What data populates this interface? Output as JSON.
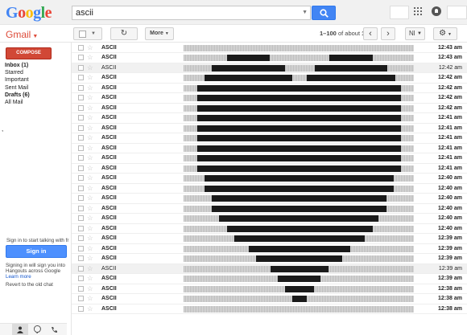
{
  "header": {
    "logo_text": "Google",
    "logo_colors": [
      "#4285f4",
      "#ea4335",
      "#fbbc05",
      "#4285f4",
      "#34a853",
      "#ea4335"
    ],
    "search_value": "ascii",
    "search_icon": "search-icon",
    "apps_icon": "apps-grid-icon",
    "notifications_icon": "notifications-icon"
  },
  "toolbar": {
    "app_label": "Gmail",
    "more_label": "More",
    "page_range": "1–100",
    "page_of": "of about",
    "page_total": "171",
    "prev_icon": "‹",
    "next_icon": "›",
    "lang_label": "Nl",
    "settings_icon": "⚙",
    "refresh_icon": "↻"
  },
  "sidebar": {
    "compose_label": "COMPOSE",
    "items": [
      {
        "label": "Inbox (1)",
        "bold": true
      },
      {
        "label": "Starred",
        "bold": false
      },
      {
        "label": "Important",
        "bold": false
      },
      {
        "label": "Sent Mail",
        "bold": false
      },
      {
        "label": "Drafts (6)",
        "bold": true
      },
      {
        "label": "All Mail",
        "bold": false
      }
    ],
    "stray_comma": ",",
    "chat_prompt": "Sign in to start talking with fr",
    "signin_label": "Sign in",
    "chat_note": "Signing in will sign you into Hangouts across Google",
    "learn_more": "Learn more",
    "old_chat": "Revert to the old chat"
  },
  "colors": {
    "accent_red": "#dd4b39",
    "compose_red": "#d14836",
    "blue_button": "#4285f4",
    "bar_black": "#1a1a1a"
  },
  "mails": [
    {
      "sender": "ASCII",
      "time": "12:43 am",
      "read": false,
      "bars": []
    },
    {
      "sender": "ASCII",
      "time": "12:43 am",
      "read": false,
      "bars": [
        [
          0.188,
          0.374
        ],
        [
          0.634,
          0.82
        ]
      ]
    },
    {
      "sender": "ASCII",
      "time": "12:42 am",
      "read": true,
      "bars": [
        [
          0.122,
          0.44
        ],
        [
          0.569,
          0.886
        ]
      ]
    },
    {
      "sender": "ASCII",
      "time": "12:42 am",
      "read": false,
      "bars": [
        [
          0.09,
          0.472
        ],
        [
          0.536,
          0.918
        ]
      ]
    },
    {
      "sender": "ASCII",
      "time": "12:42 am",
      "read": false,
      "bars": [
        [
          0.058,
          0.944
        ]
      ]
    },
    {
      "sender": "ASCII",
      "time": "12:42 am",
      "read": false,
      "bars": [
        [
          0.058,
          0.944
        ]
      ]
    },
    {
      "sender": "ASCII",
      "time": "12:42 am",
      "read": false,
      "bars": [
        [
          0.058,
          0.944
        ]
      ]
    },
    {
      "sender": "ASCII",
      "time": "12:41 am",
      "read": false,
      "bars": [
        [
          0.058,
          0.944
        ]
      ]
    },
    {
      "sender": "ASCII",
      "time": "12:41 am",
      "read": false,
      "bars": [
        [
          0.058,
          0.944
        ]
      ]
    },
    {
      "sender": "ASCII",
      "time": "12:41 am",
      "read": false,
      "bars": [
        [
          0.058,
          0.944
        ]
      ]
    },
    {
      "sender": "ASCII",
      "time": "12:41 am",
      "read": false,
      "bars": [
        [
          0.058,
          0.944
        ]
      ]
    },
    {
      "sender": "ASCII",
      "time": "12:41 am",
      "read": false,
      "bars": [
        [
          0.058,
          0.944
        ]
      ]
    },
    {
      "sender": "ASCII",
      "time": "12:41 am",
      "read": false,
      "bars": [
        [
          0.058,
          0.944
        ]
      ]
    },
    {
      "sender": "ASCII",
      "time": "12:40 am",
      "read": false,
      "bars": [
        [
          0.09,
          0.912
        ]
      ]
    },
    {
      "sender": "ASCII",
      "time": "12:40 am",
      "read": false,
      "bars": [
        [
          0.09,
          0.912
        ]
      ]
    },
    {
      "sender": "ASCII",
      "time": "12:40 am",
      "read": false,
      "bars": [
        [
          0.122,
          0.88
        ]
      ]
    },
    {
      "sender": "ASCII",
      "time": "12:40 am",
      "read": false,
      "bars": [
        [
          0.122,
          0.88
        ]
      ]
    },
    {
      "sender": "ASCII",
      "time": "12:40 am",
      "read": false,
      "bars": [
        [
          0.154,
          0.846
        ]
      ]
    },
    {
      "sender": "ASCII",
      "time": "12:40 am",
      "read": false,
      "bars": [
        [
          0.188,
          0.82
        ]
      ]
    },
    {
      "sender": "ASCII",
      "time": "12:39 am",
      "read": false,
      "bars": [
        [
          0.22,
          0.787
        ]
      ]
    },
    {
      "sender": "ASCII",
      "time": "12:39 am",
      "read": false,
      "bars": [
        [
          0.282,
          0.723
        ]
      ]
    },
    {
      "sender": "ASCII",
      "time": "12:39 am",
      "read": false,
      "bars": [
        [
          0.315,
          0.69
        ]
      ]
    },
    {
      "sender": "ASCII",
      "time": "12:39 am",
      "read": true,
      "bars": [
        [
          0.378,
          0.628
        ]
      ]
    },
    {
      "sender": "ASCII",
      "time": "12:39 am",
      "read": false,
      "bars": [
        [
          0.41,
          0.595
        ]
      ]
    },
    {
      "sender": "ASCII",
      "time": "12:38 am",
      "read": false,
      "bars": [
        [
          0.441,
          0.566
        ]
      ]
    },
    {
      "sender": "ASCII",
      "time": "12:38 am",
      "read": false,
      "bars": [
        [
          0.473,
          0.534
        ]
      ]
    },
    {
      "sender": "ASCII",
      "time": "12:38 am",
      "read": false,
      "bars": []
    }
  ]
}
